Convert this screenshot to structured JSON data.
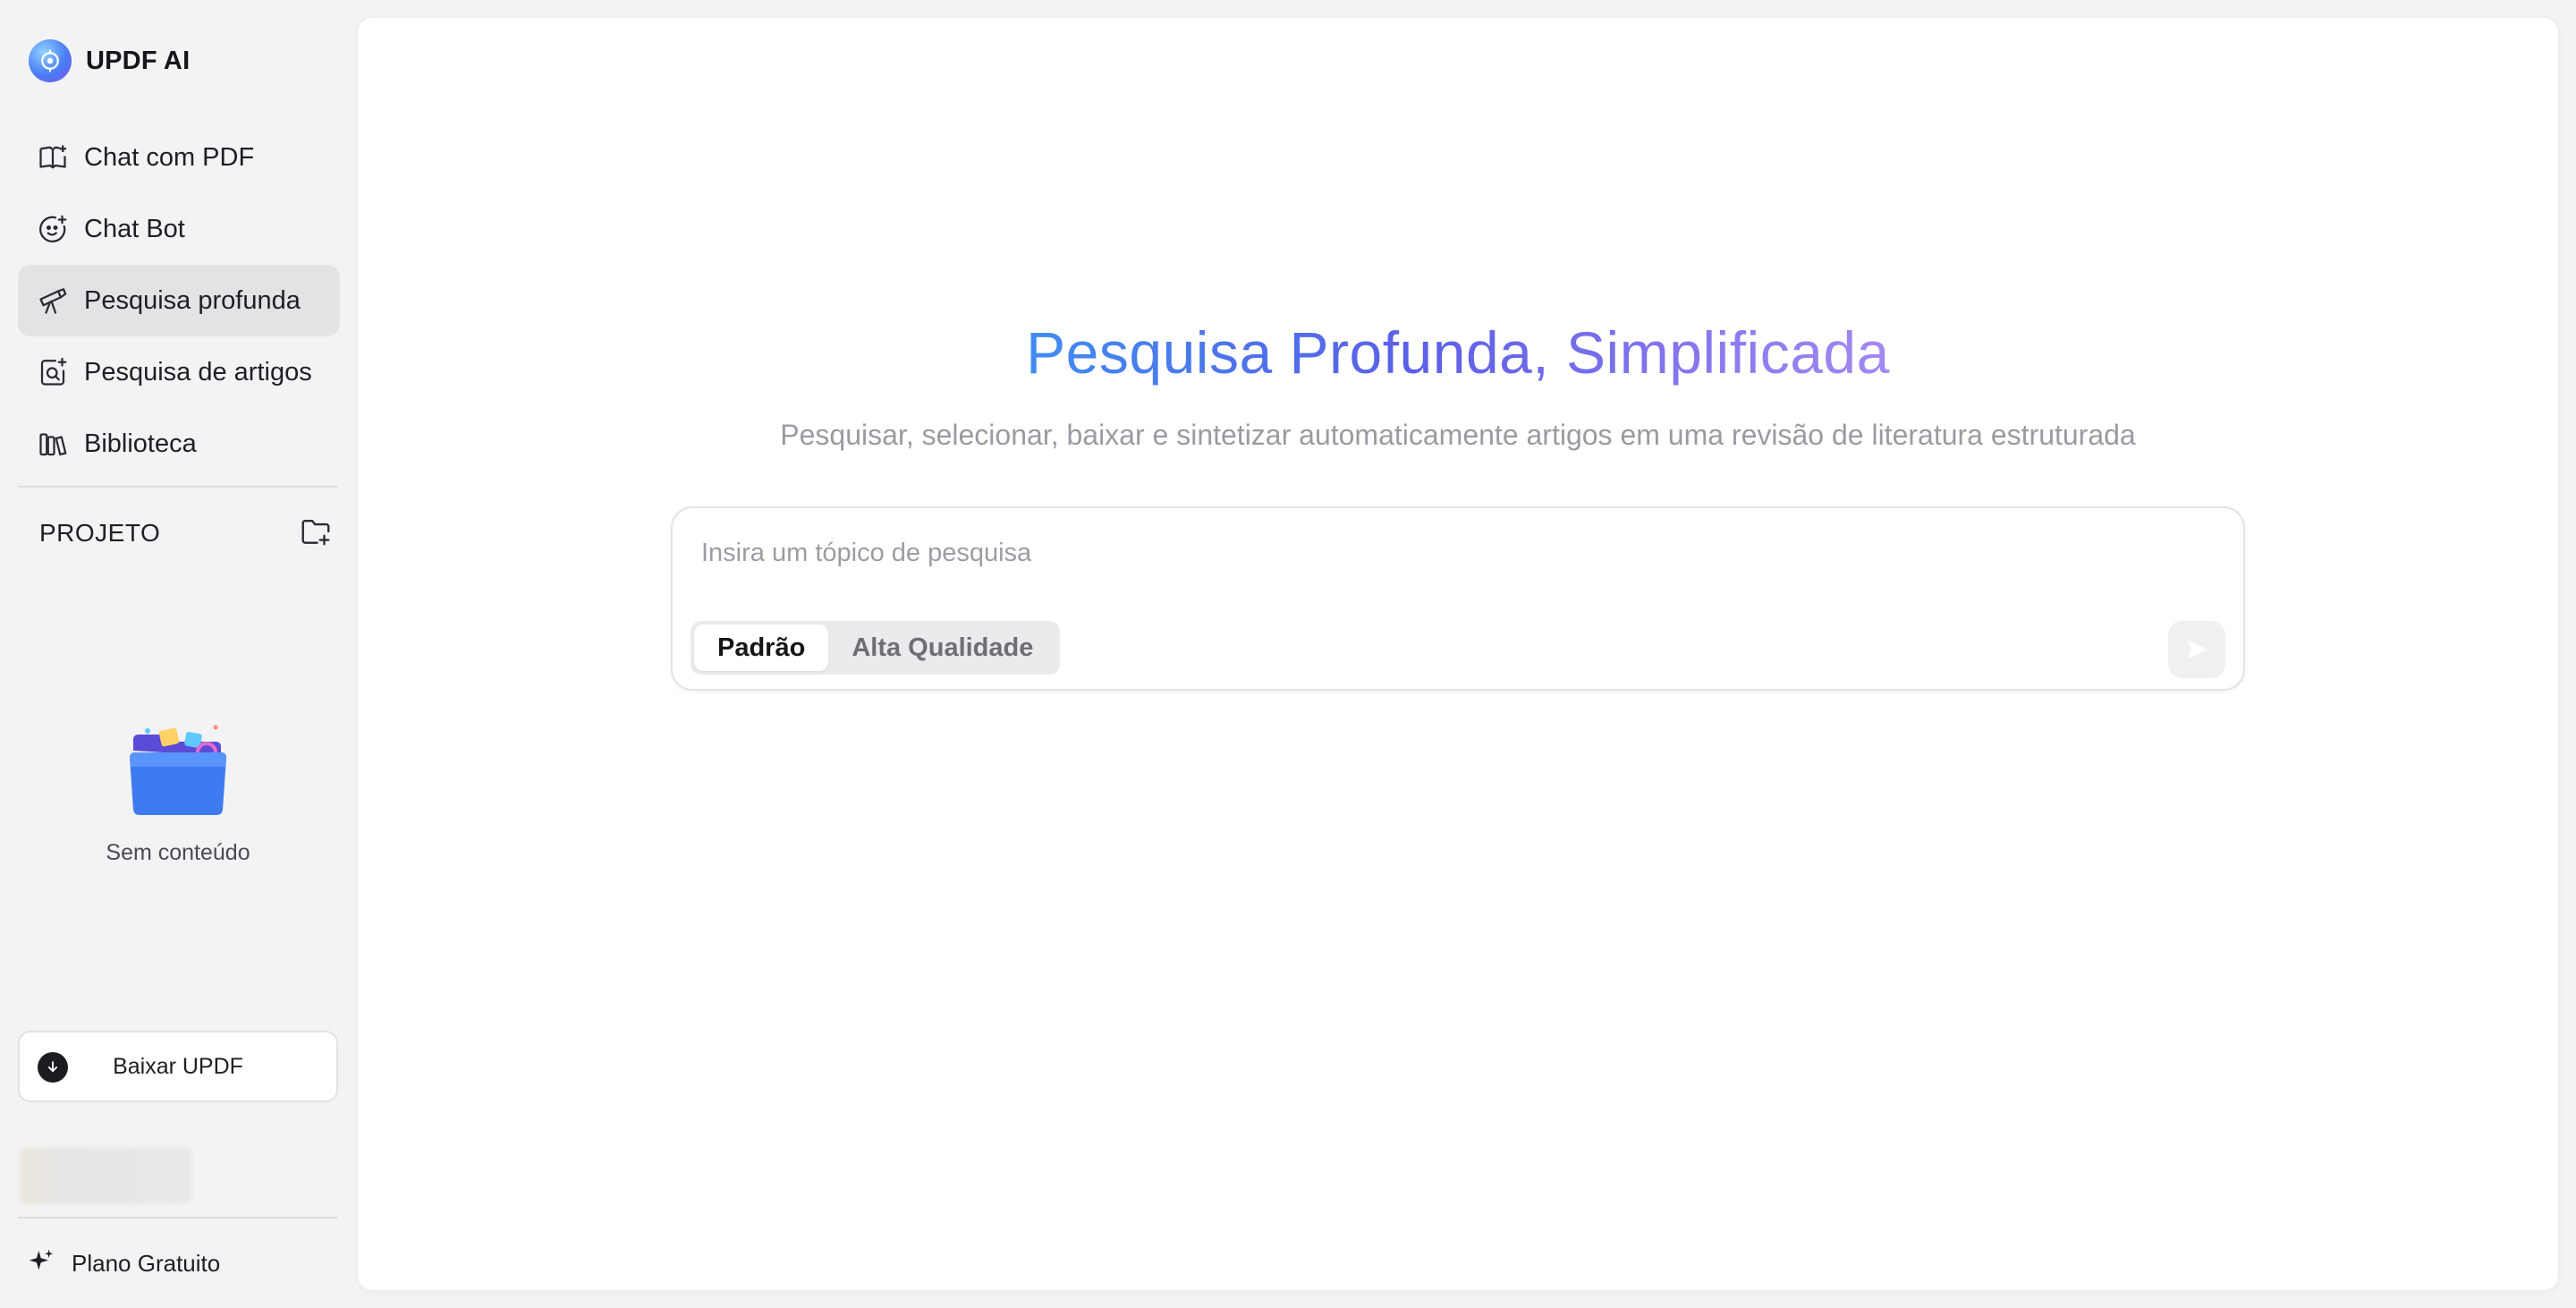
{
  "brand": {
    "name": "UPDF AI"
  },
  "sidebar": {
    "items": [
      {
        "label": "Chat com PDF",
        "icon": "open-book-icon",
        "active": false
      },
      {
        "label": "Chat Bot",
        "icon": "bot-face-icon",
        "active": false
      },
      {
        "label": "Pesquisa profunda",
        "icon": "telescope-icon",
        "active": true
      },
      {
        "label": "Pesquisa de artigos",
        "icon": "document-search-icon",
        "active": false
      },
      {
        "label": "Biblioteca",
        "icon": "library-icon",
        "active": false
      }
    ],
    "project_label": "PROJETO",
    "project_add_icon": "folder-add-icon",
    "empty_text": "Sem conteúdo",
    "download_label": "Baixar UPDF",
    "plan_label": "Plano Gratuito"
  },
  "main": {
    "title": "Pesquisa Profunda, Simplificada",
    "subtitle": "Pesquisar, selecionar, baixar e sintetizar automaticamente artigos em uma revisão de literatura estruturada",
    "search_placeholder": "Insira um tópico de pesquisa",
    "search_value": "",
    "modes": [
      {
        "label": "Padrão",
        "active": true
      },
      {
        "label": "Alta Qualidade",
        "active": false
      }
    ]
  },
  "colors": {
    "accent_blue": "#3f8cf2",
    "accent_violet": "#a488f2",
    "sidebar_bg": "#f3f3f5",
    "active_item_bg": "#e3e3e6"
  }
}
